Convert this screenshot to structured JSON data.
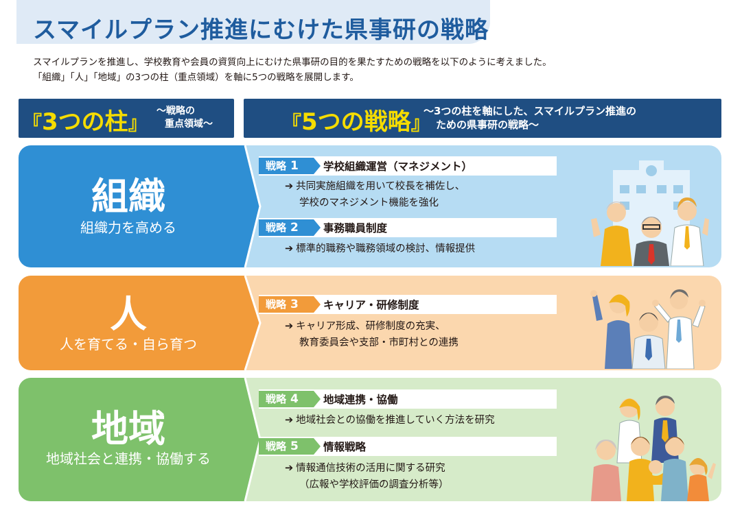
{
  "title": "スマイルプラン推進にむけた県事研の戦略",
  "intro": {
    "line1": "スマイルプランを推進し、学校教育や会員の資質向上にむけた県事研の目的を果たすための戦略を以下のように考えました。",
    "line2": "「組織」「人」「地域」の3つの柱（重点領域）を軸に5つの戦略を展開します。"
  },
  "header_left": {
    "open_bracket": "『",
    "big": "3つの柱",
    "close_bracket": "』",
    "sub1": "～戦略の",
    "sub2": "重点領域～"
  },
  "header_right": {
    "open_bracket": "『",
    "big": "5つの戦略",
    "close_bracket": "』",
    "sub1": "～3つの柱を軸にした、スマイルプラン推進の",
    "sub2": "ための県事研の戦略～"
  },
  "pillars": [
    {
      "name": "組織",
      "subtitle": "組織力を高める",
      "strategies": [
        {
          "badge": "戦略",
          "num": "1",
          "title": "学校組織運営（マネジメント）",
          "desc": [
            "学校組織運営（マネジメント）"
          ],
          "lines": [
            "共同実施組織を用いて校長を補佐し、",
            "学校のマネジメント機能を強化"
          ]
        },
        {
          "badge": "戦略",
          "num": "2",
          "title": "事務職員制度",
          "lines": [
            "標準的職務や職務領域の検討、情報提供"
          ]
        }
      ],
      "colors": {
        "left": "#2f8fd4",
        "right": "#b6dcf3",
        "badge": "#2f8fd4"
      }
    },
    {
      "name": "人",
      "subtitle": "人を育てる・自ら育つ",
      "strategies": [
        {
          "badge": "戦略",
          "num": "3",
          "title": "キャリア・研修制度",
          "lines": [
            "キャリア形成、研修制度の充実、",
            "教育委員会や支部・市町村との連携"
          ]
        }
      ],
      "colors": {
        "left": "#f29b3a",
        "right": "#fbd7ae",
        "badge": "#f29b3a"
      }
    },
    {
      "name": "地域",
      "subtitle": "地域社会と連携・協働する",
      "strategies": [
        {
          "badge": "戦略",
          "num": "4",
          "title": "地域連携・協働",
          "lines": [
            "地域社会との協働を推進していく方法を研究"
          ]
        },
        {
          "badge": "戦略",
          "num": "5",
          "title": "情報戦略",
          "lines": [
            "情報通信技術の活用に関する研究",
            "（広報や学校評価の調査分析等）"
          ]
        }
      ],
      "colors": {
        "left": "#7ec16b",
        "right": "#d6ebc9",
        "badge": "#7ec16b"
      }
    }
  ],
  "arrow_glyph": "➔",
  "illustrations": {
    "row1": "office-workers-illustration",
    "row2": "cheering-team-illustration",
    "row3": "community-group-illustration"
  }
}
